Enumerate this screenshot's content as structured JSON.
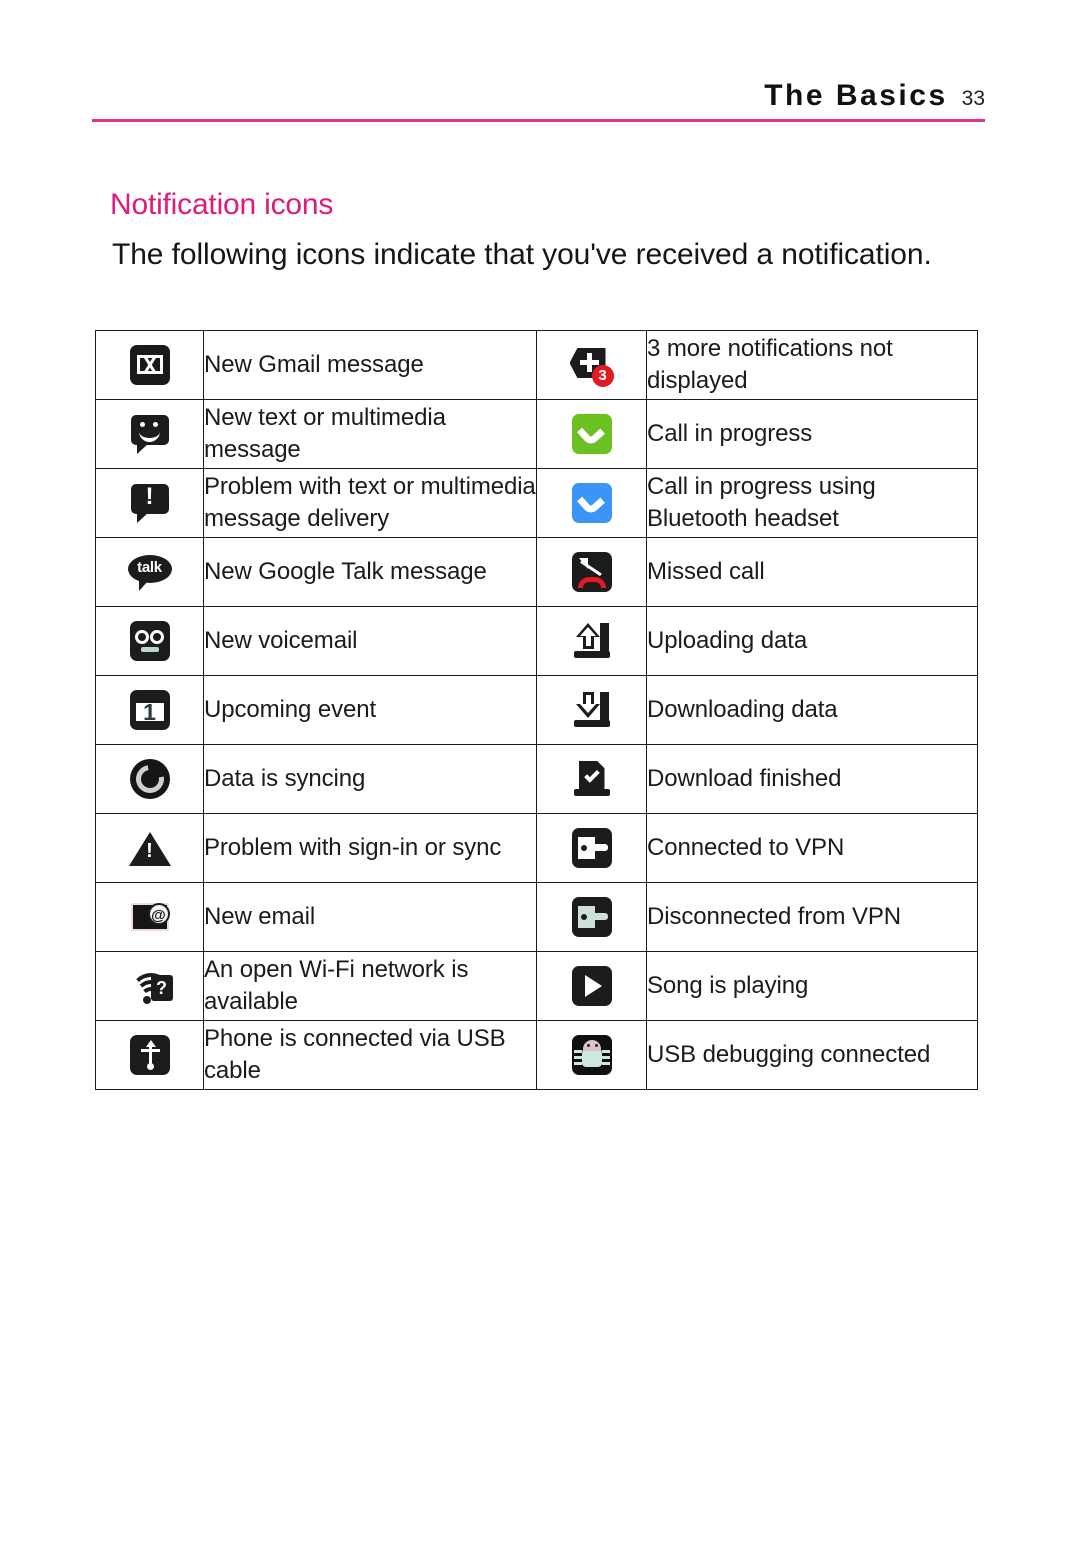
{
  "header": {
    "title": "The Basics",
    "page_number": "33",
    "rule_color": "#e0338c"
  },
  "section": {
    "heading": "Notification icons",
    "heading_color": "#e0197c",
    "intro": "The following icons indicate that you've received a notification."
  },
  "table": {
    "rows": [
      {
        "left_icon": "gmail-icon",
        "left_label": "New Gmail message",
        "right_icon": "more-notifications-icon",
        "right_label": "3 more notifications not displayed",
        "right_badge": "3"
      },
      {
        "left_icon": "sms-smiley-icon",
        "left_label": "New text or multimedia message",
        "right_icon": "call-in-progress-icon",
        "right_label": "Call in progress"
      },
      {
        "left_icon": "sms-problem-icon",
        "left_label": "Problem with text or multimedia message delivery",
        "right_icon": "call-bluetooth-icon",
        "right_label": "Call in progress using Bluetooth headset"
      },
      {
        "left_icon": "google-talk-icon",
        "left_label": "New Google Talk message",
        "left_icon_text": "talk",
        "right_icon": "missed-call-icon",
        "right_label": "Missed call"
      },
      {
        "left_icon": "voicemail-icon",
        "left_label": "New voicemail",
        "right_icon": "upload-icon",
        "right_label": "Uploading data"
      },
      {
        "left_icon": "calendar-event-icon",
        "left_label": "Upcoming event",
        "left_icon_text": "1",
        "right_icon": "download-icon",
        "right_label": "Downloading data"
      },
      {
        "left_icon": "sync-icon",
        "left_label": "Data is syncing",
        "right_icon": "download-finished-icon",
        "right_label": "Download finished"
      },
      {
        "left_icon": "warning-triangle-icon",
        "left_label": "Problem with sign-in or sync",
        "right_icon": "vpn-connected-icon",
        "right_label": "Connected to VPN"
      },
      {
        "left_icon": "new-email-icon",
        "left_label": "New email",
        "right_icon": "vpn-disconnected-icon",
        "right_label": "Disconnected from VPN"
      },
      {
        "left_icon": "wifi-open-network-icon",
        "left_label": "An open Wi-Fi network is available",
        "right_icon": "play-icon",
        "right_label": "Song is playing"
      },
      {
        "left_icon": "usb-icon",
        "left_label": "Phone is connected via USB cable",
        "right_icon": "usb-debugging-bug-icon",
        "right_label": "USB debugging connected"
      }
    ]
  },
  "colors": {
    "call_green": "#6cc122",
    "call_blue": "#3b95f5",
    "badge_red": "#e01b22",
    "accent_pink": "#e0197c"
  }
}
